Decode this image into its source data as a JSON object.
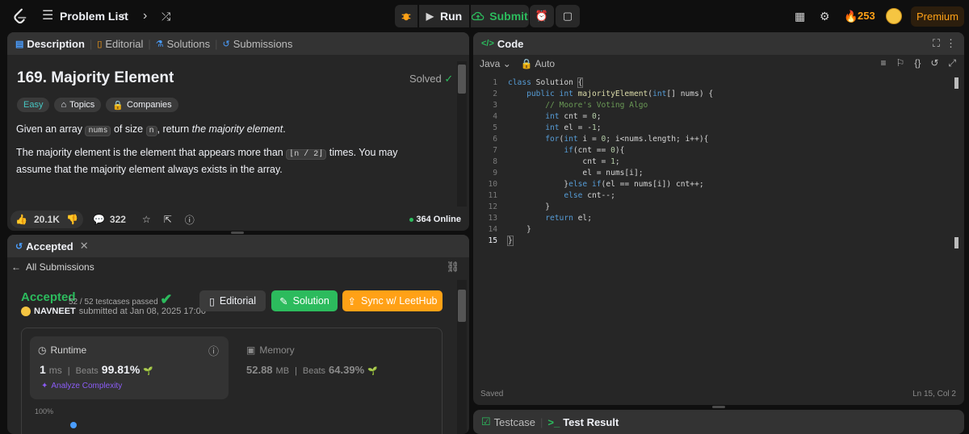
{
  "topbar": {
    "problem_list": "Problem List",
    "run": "Run",
    "submit": "Submit",
    "streak": "253",
    "premium": "Premium"
  },
  "description": {
    "tabs": [
      "Description",
      "Editorial",
      "Solutions",
      "Submissions"
    ],
    "title": "169. Majority Element",
    "solved": "Solved",
    "difficulty": "Easy",
    "topics": "Topics",
    "companies": "Companies",
    "p1_a": "Given an array ",
    "p1_code1": "nums",
    "p1_b": " of size ",
    "p1_code2": "n",
    "p1_c": ", return ",
    "p1_em": "the majority element",
    "p1_d": ".",
    "p2_a": "The majority element is the element that appears more than ",
    "p2_code": "⌊n / 2⌋",
    "p2_b": " times. You may assume that the majority element always exists in the array.",
    "likes": "20.1K",
    "comments": "322",
    "online": "364 Online"
  },
  "submission": {
    "tab": "Accepted",
    "back": "All Submissions",
    "status": "Accepted",
    "testcases": "52 / 52 testcases passed",
    "user": "NAVNEET",
    "submitted": "submitted at Jan 08, 2025 17:06",
    "editorial_btn": "Editorial",
    "solution_btn": "Solution",
    "sync_btn": "Sync w/ LeetHub",
    "runtime_label": "Runtime",
    "runtime_value": "1",
    "runtime_unit": "ms",
    "beats": "Beats",
    "runtime_beats": "99.81%",
    "analyze": "Analyze Complexity",
    "memory_label": "Memory",
    "memory_value": "52.88",
    "memory_unit": "MB",
    "memory_beats": "64.39%",
    "chart_top": "100%"
  },
  "code": {
    "title": "Code",
    "language": "Java",
    "mode": "Auto",
    "saved": "Saved",
    "cursor": "Ln 15, Col 2",
    "line_numbers": [
      "1",
      "2",
      "3",
      "4",
      "5",
      "6",
      "7",
      "8",
      "9",
      "10",
      "11",
      "12",
      "13",
      "14",
      "15"
    ]
  },
  "bottom": {
    "testcase": "Testcase",
    "test_result": "Test Result"
  }
}
